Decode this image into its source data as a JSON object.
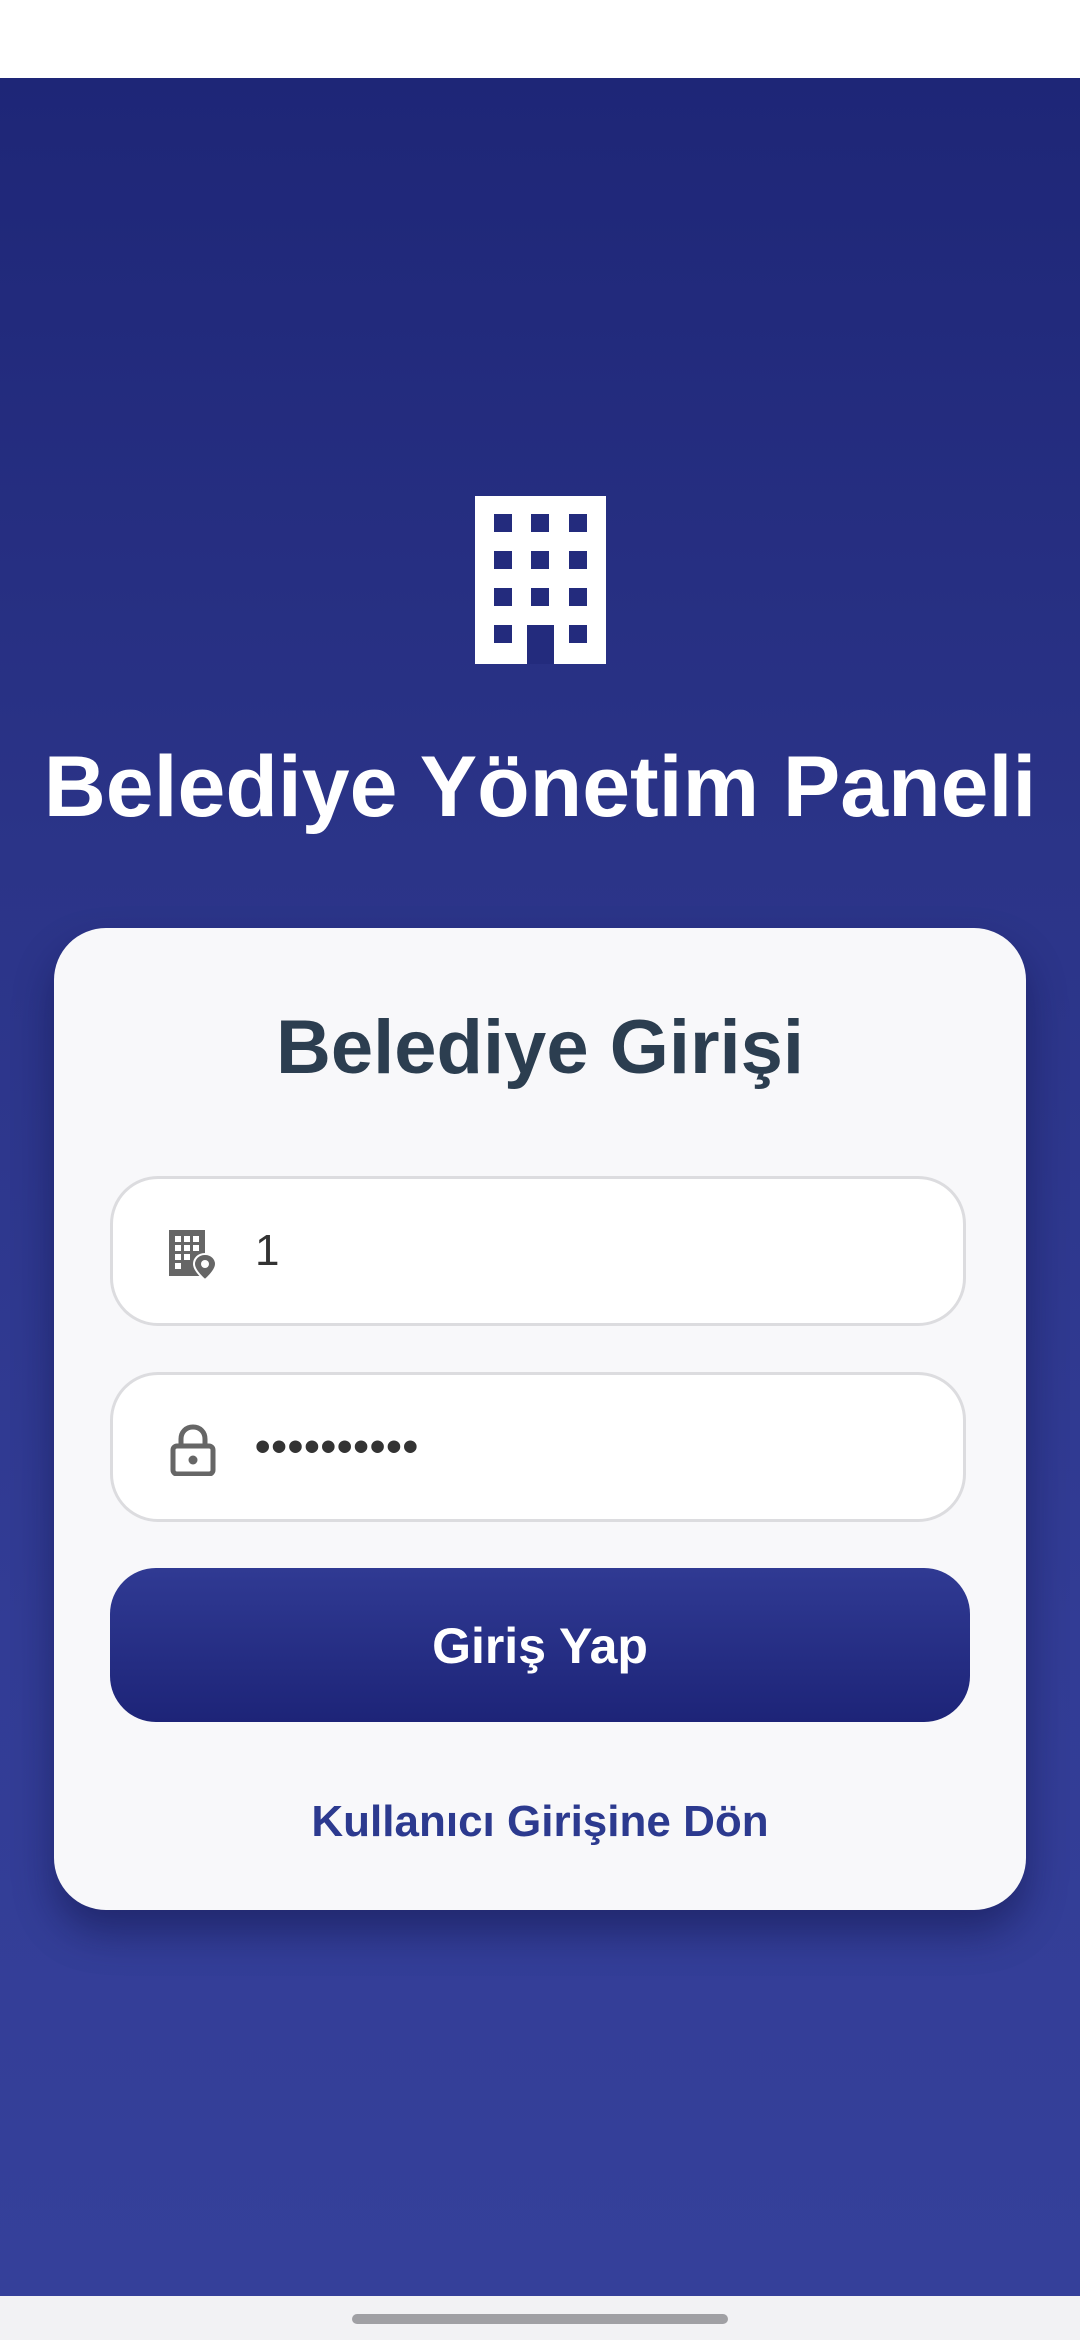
{
  "app": {
    "title": "Belediye Yönetim Paneli",
    "logo_icon": "building-icon"
  },
  "login_card": {
    "title": "Belediye Girişi",
    "municipality_field": {
      "icon": "location-city-icon",
      "value": "1"
    },
    "password_field": {
      "icon": "lock-icon",
      "value": "••••••••••"
    },
    "submit_label": "Giriş Yap",
    "back_link_label": "Kullanıcı Girişine Dön"
  },
  "colors": {
    "background_top": "#1e2677",
    "background_bottom": "#35409a",
    "card": "#f8f8fa",
    "card_title": "#2c3e50",
    "button": "#1d2478",
    "link": "#2c3a8f"
  }
}
